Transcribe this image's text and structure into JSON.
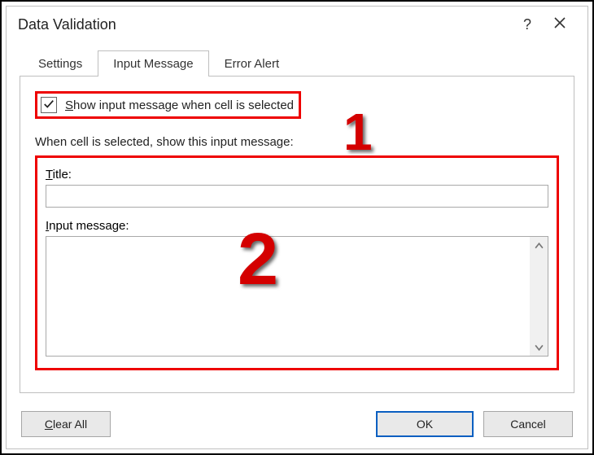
{
  "window": {
    "title": "Data Validation",
    "help_tooltip": "?"
  },
  "tabs": [
    {
      "label": "Settings",
      "active": false
    },
    {
      "label": "Input Message",
      "active": true
    },
    {
      "label": "Error Alert",
      "active": false
    }
  ],
  "checkbox": {
    "checked": true,
    "label_pre_underline": "",
    "label_underline": "S",
    "label_post_underline": "how input message when cell is selected"
  },
  "section_heading": "When cell is selected, show this input message:",
  "fields": {
    "title_label_underline": "T",
    "title_label_rest": "itle:",
    "title_value": "",
    "message_label_underline": "I",
    "message_label_rest": "nput message:",
    "message_value": ""
  },
  "buttons": {
    "clear_underline": "C",
    "clear_rest": "lear All",
    "ok": "OK",
    "cancel": "Cancel"
  },
  "callouts": {
    "one": "1",
    "two": "2"
  }
}
